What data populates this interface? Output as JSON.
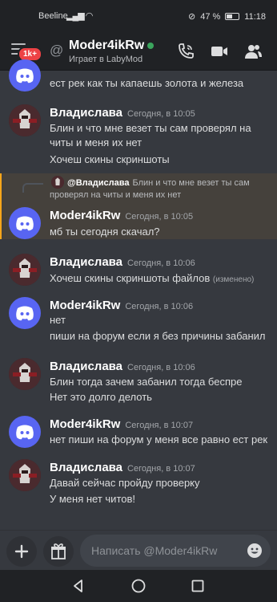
{
  "status_bar": {
    "carrier": "Beeline",
    "battery": "47 %",
    "time": "11:18"
  },
  "header": {
    "badge": "1k+",
    "at_symbol": "@",
    "title": "Moder4ikRw",
    "subtitle": "Играет в LabyMod",
    "icons": [
      "menu-icon",
      "call-icon",
      "video-icon",
      "members-icon"
    ],
    "online_color": "#3ba55d"
  },
  "messages": {
    "partial": {
      "text": "ест рек как ты капаешь  золота и железа"
    },
    "m1": {
      "author": "Владислава",
      "time": "Сегодня, в 10:05",
      "lines": [
        "Блин и что мне везет ты сам проверял на",
        "читы и меня их нет",
        "Хочеш скины скриншоты"
      ]
    },
    "reply": {
      "ref_author": "@Владислава",
      "ref_text_1": "Блин и что мне везет ты сам",
      "ref_text_2": "проверял на читы и меня их нет"
    },
    "m2": {
      "author": "Moder4ikRw",
      "time": "Сегодня, в 10:05",
      "lines": [
        "мб ты сегодня скачал?"
      ]
    },
    "m3": {
      "author": "Владислава",
      "time": "Сегодня, в 10:06",
      "lines": [
        "Хочеш скины скриншоты файлов"
      ],
      "edited": "(изменено)"
    },
    "m4": {
      "author": "Moder4ikRw",
      "time": "Сегодня, в 10:06",
      "lines": [
        "нет",
        "пиши на форум если я без причины забанил"
      ]
    },
    "m5": {
      "author": "Владислава",
      "time": "Сегодня, в 10:06",
      "lines": [
        "Блин тогда зачем забанил тогда беспре",
        "Нет это долго делоть"
      ]
    },
    "m6": {
      "author": "Moder4ikRw",
      "time": "Сегодня, в 10:07",
      "lines": [
        "нет пиши на форум у меня все равно ест рек"
      ]
    },
    "m7": {
      "author": "Владислава",
      "time": "Сегодня, в 10:07",
      "lines": [
        "Давай сейчас пройду проверку",
        "У меня нет читов!"
      ]
    }
  },
  "composer": {
    "placeholder": "Написать @Moder4ikRw",
    "icons": [
      "plus-icon",
      "gift-icon",
      "emoji-icon"
    ]
  },
  "navbar": {
    "icons": [
      "back-icon",
      "home-icon",
      "recents-icon"
    ]
  },
  "colors": {
    "accent": "#5865f2",
    "reply_highlight": "#faa61a",
    "badge": "#ed4245"
  }
}
